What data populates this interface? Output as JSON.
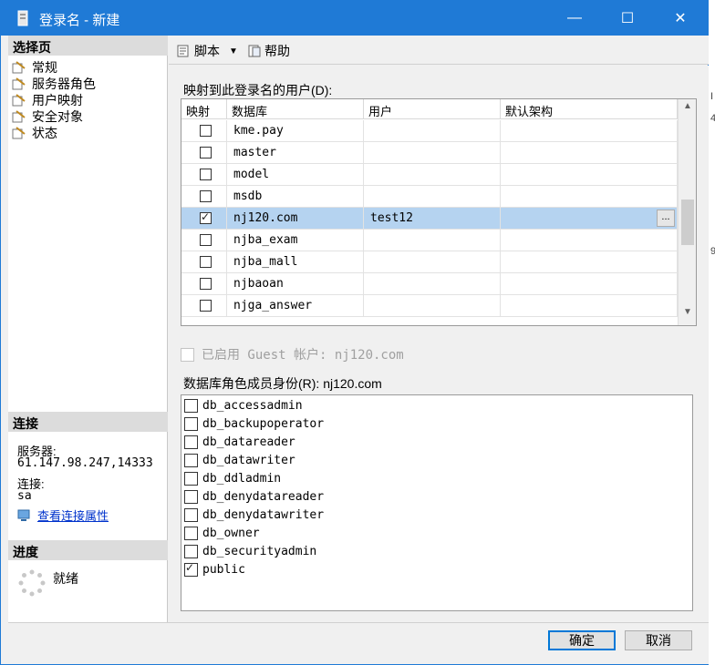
{
  "window": {
    "title": "登录名 - 新建",
    "minimize": "—",
    "maximize": "☐",
    "close": "✕"
  },
  "left": {
    "select_page_header": "选择页",
    "pages": [
      "常规",
      "服务器角色",
      "用户映射",
      "安全对象",
      "状态"
    ],
    "connection_header": "连接",
    "server_label": "服务器:",
    "server_value": "61.147.98.247,14333",
    "connection_label": "连接:",
    "connection_value": "sa",
    "view_conn_props": "查看连接属性",
    "progress_header": "进度",
    "progress_status": "就绪"
  },
  "toolbar": {
    "script_label": "脚本",
    "help_label": "帮助"
  },
  "mapping": {
    "label": "映射到此登录名的用户(D):",
    "columns": [
      "映射",
      "数据库",
      "用户",
      "默认架构"
    ],
    "rows": [
      {
        "mapped": false,
        "db": "kme.pay",
        "user": "",
        "schema": ""
      },
      {
        "mapped": false,
        "db": "master",
        "user": "",
        "schema": ""
      },
      {
        "mapped": false,
        "db": "model",
        "user": "",
        "schema": ""
      },
      {
        "mapped": false,
        "db": "msdb",
        "user": "",
        "schema": ""
      },
      {
        "mapped": true,
        "db": "nj120.com",
        "user": "test12",
        "schema": "",
        "selected": true
      },
      {
        "mapped": false,
        "db": "njba_exam",
        "user": "",
        "schema": ""
      },
      {
        "mapped": false,
        "db": "njba_mall",
        "user": "",
        "schema": ""
      },
      {
        "mapped": false,
        "db": "njbaoan",
        "user": "",
        "schema": ""
      },
      {
        "mapped": false,
        "db": "njga_answer",
        "user": "",
        "schema": ""
      }
    ],
    "ellipsis": "..."
  },
  "guest": {
    "label": "已启用 Guest 帐户: nj120.com"
  },
  "roles": {
    "label": "数据库角色成员身份(R): nj120.com",
    "items": [
      {
        "name": "db_accessadmin",
        "checked": false
      },
      {
        "name": "db_backupoperator",
        "checked": false
      },
      {
        "name": "db_datareader",
        "checked": false
      },
      {
        "name": "db_datawriter",
        "checked": false
      },
      {
        "name": "db_ddladmin",
        "checked": false
      },
      {
        "name": "db_denydatareader",
        "checked": false
      },
      {
        "name": "db_denydatawriter",
        "checked": false
      },
      {
        "name": "db_owner",
        "checked": false
      },
      {
        "name": "db_securityadmin",
        "checked": false
      },
      {
        "name": "public",
        "checked": true
      }
    ]
  },
  "footer": {
    "ok": "确定",
    "cancel": "取消"
  },
  "colors": {
    "titlebar": "#1f7ad6",
    "selected_row": "#b5d3f0",
    "link": "#0033cc"
  }
}
